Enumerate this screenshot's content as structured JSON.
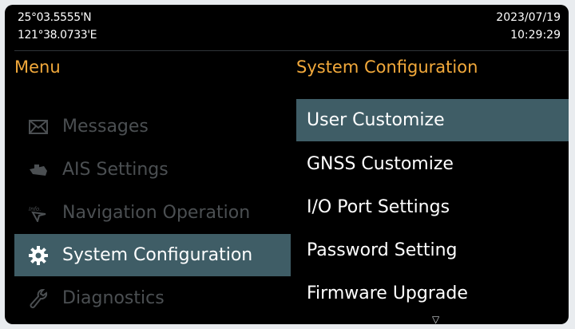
{
  "status": {
    "latitude": "25°03.5555'N",
    "longitude": "121°38.0733'E",
    "date": "2023/07/19",
    "time": "10:29:29"
  },
  "left_panel": {
    "title": "Menu",
    "items": [
      {
        "label": "Messages",
        "icon": "envelope-icon",
        "state": "disabled"
      },
      {
        "label": "AIS Settings",
        "icon": "ship-icon",
        "state": "disabled"
      },
      {
        "label": "Navigation Operation",
        "icon": "info-navigation-icon",
        "state": "disabled"
      },
      {
        "label": "System Configuration",
        "icon": "gear-icon",
        "state": "active"
      },
      {
        "label": "Diagnostics",
        "icon": "wrench-icon",
        "state": "disabled"
      }
    ]
  },
  "right_panel": {
    "title": "System Configuration",
    "items": [
      {
        "label": "User Customize",
        "state": "selected"
      },
      {
        "label": "GNSS Customize"
      },
      {
        "label": "I/O Port Settings"
      },
      {
        "label": "Password Setting"
      },
      {
        "label": "Firmware Upgrade"
      }
    ],
    "more_indicator": "▽"
  },
  "colors": {
    "accent_title": "#f2a93b",
    "highlight": "#3f5d66",
    "disabled_text": "#4b4f52",
    "background": "#000000"
  }
}
